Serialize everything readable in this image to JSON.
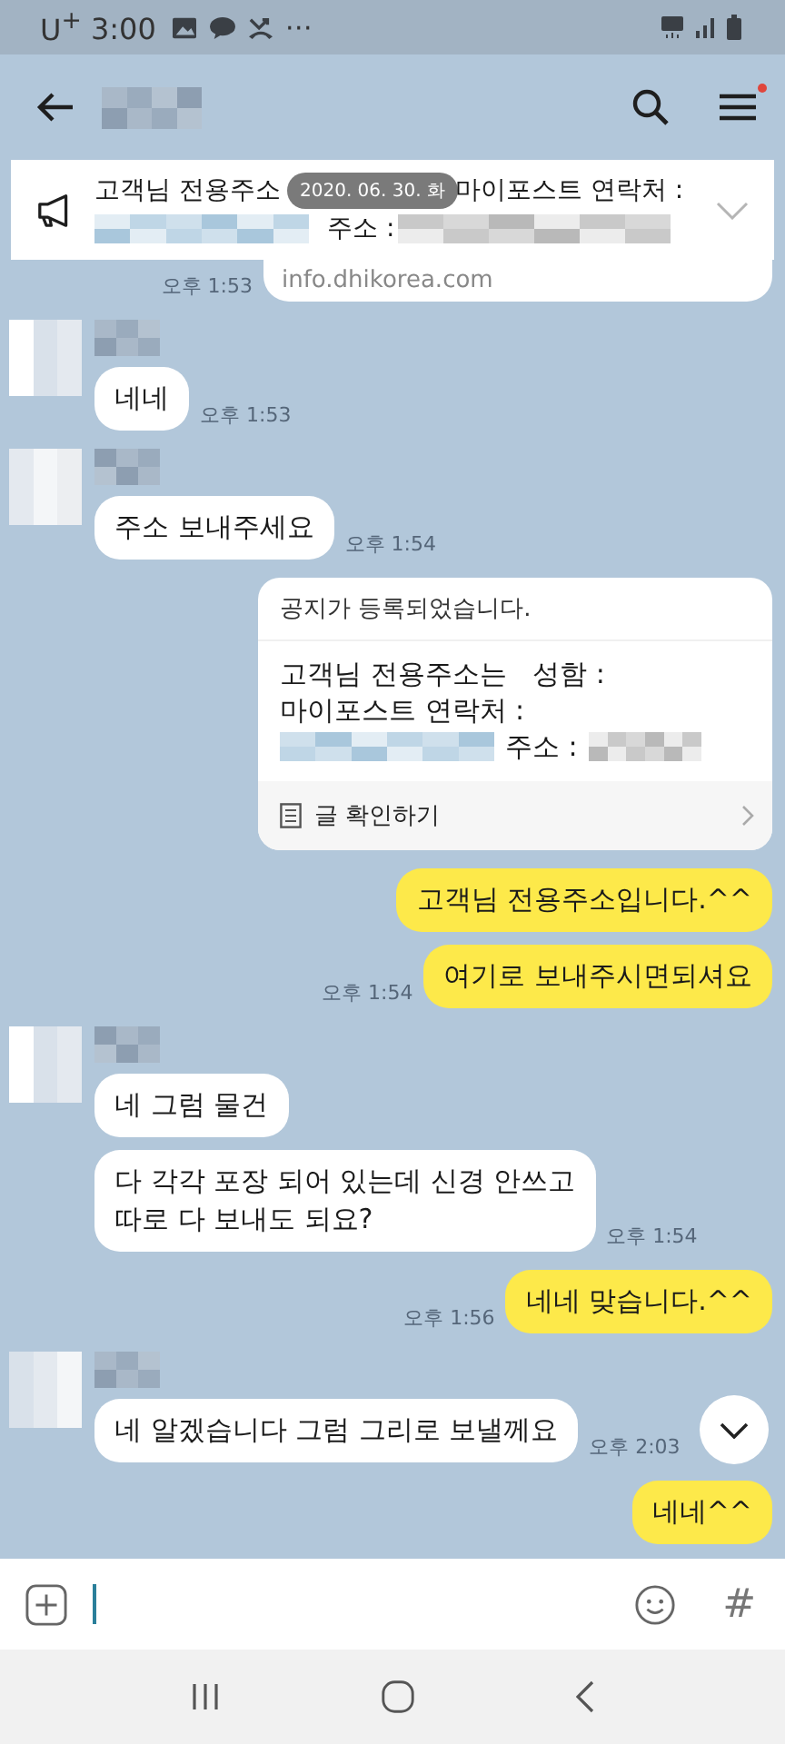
{
  "status_bar": {
    "carrier": "U$^{+}$",
    "time": "3:00",
    "more": "⋯"
  },
  "header": {
    "menu_badge": true
  },
  "notice_banner": {
    "line_1": [
      "고객님 전용주소",
      "마이포스트 연락처 :"
    ],
    "line_2_label": "주소 :",
    "date": "2020. 06. 30. 화",
    "expanded": false
  },
  "messages": [
    {
      "kind": "notice_tail",
      "text": "info.dhikorea.com",
      "time": "오후 1:53"
    },
    {
      "kind": "incoming",
      "first": true,
      "text": "네네",
      "time": "오후 1:53"
    },
    {
      "kind": "incoming",
      "first": true,
      "text": "주소 보내주세요",
      "time": "오후 1:54"
    },
    {
      "kind": "notice",
      "title": "공지가 등록되었습니다.",
      "lines": [
        [
          {
            "kind": "text",
            "text": "고객님 전용주소는   성함 :"
          }
        ],
        [
          {
            "kind": "text",
            "text": "마이포스트 연락처 :"
          }
        ],
        [
          {
            "kind": "redacted"
          },
          {
            "kind": "text",
            "text": "주소 :"
          },
          {
            "kind": "redacted"
          }
        ]
      ],
      "link": "글 확인하기"
    },
    {
      "kind": "outgoing",
      "text": "고객님 전용주소입니다.^^"
    },
    {
      "kind": "outgoing",
      "text": "여기로 보내주시면되셔요",
      "time": "오후 1:54"
    },
    {
      "kind": "incoming",
      "first": true,
      "text": "네 그럼 물건"
    },
    {
      "kind": "incoming",
      "first": false,
      "text": "다 각각 포장 되어 있는데 신경 안쓰고\n따로 다 보내도 되요?",
      "time": "오후 1:54"
    },
    {
      "kind": "outgoing",
      "text": "네네 맞습니다.^^",
      "time": "오후 1:56"
    },
    {
      "kind": "incoming",
      "first": true,
      "text": "네 알겠습니다 그럼 그리로 보낼께요",
      "time": "오후 2:03"
    },
    {
      "kind": "outgoing",
      "text": "네네^^"
    }
  ],
  "input": {
    "hash": "#"
  }
}
